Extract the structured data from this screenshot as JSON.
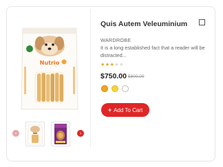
{
  "product": {
    "title": "Quis Autem Veleuminium",
    "category": "WARDROBE",
    "description": "It is a long established fact that a reader will be distracted...",
    "rating": {
      "filled": 3,
      "total": 5
    },
    "price": "$750.00",
    "old_price": "$800.00",
    "swatches": [
      "#f1a51e",
      "#f7d33a",
      "#ffffff"
    ],
    "add_to_cart_label": "Add To Cart",
    "package_brand": "Nutrio",
    "icons": {
      "wishlist": "checkbox-square-icon",
      "prev": "chevron-left-icon",
      "next": "chevron-right-icon",
      "cart_plus": "plus-icon"
    }
  }
}
